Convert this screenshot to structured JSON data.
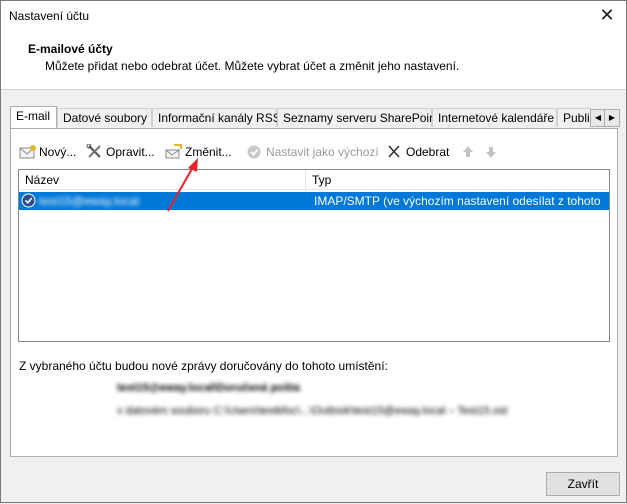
{
  "window": {
    "title": "Nastavení účtu",
    "close_glyph": "✕"
  },
  "header": {
    "title": "E-mailové účty",
    "description": "Můžete přidat nebo odebrat účet. Můžete vybrat účet a změnit jeho nastavení."
  },
  "tabs": [
    {
      "label": "E-mail"
    },
    {
      "label": "Datové soubory"
    },
    {
      "label": "Informační kanály RSS"
    },
    {
      "label": "Seznamy serveru SharePoint"
    },
    {
      "label": "Internetové kalendáře"
    },
    {
      "label": "Publi"
    }
  ],
  "tab_scroll": {
    "left": "◀",
    "right": "▶"
  },
  "toolbar": {
    "new": "Nový...",
    "repair": "Opravit...",
    "change": "Změnit...",
    "set_default": "Nastavit jako výchozí",
    "remove": "Odebrat"
  },
  "list": {
    "columns": {
      "name": "Název",
      "type": "Typ"
    },
    "rows": [
      {
        "name": "test15@eway.local",
        "type": "IMAP/SMTP (ve výchozím nastavení odesílat z tohoto účtu)"
      }
    ]
  },
  "info": {
    "label": "Z vybraného účtu budou nové zprávy doručovány do tohoto umístění:",
    "location_title": "test15@eway.local\\Doručená pošta",
    "location_path": "v datovém souboru C:\\Users\\testkfoc\\...\\Outlook\\test15@eway.local – Test15.ost"
  },
  "buttons": {
    "close": "Zavřít"
  },
  "colors": {
    "selection": "#0078d7",
    "annotation_arrow": "#e8212b"
  }
}
